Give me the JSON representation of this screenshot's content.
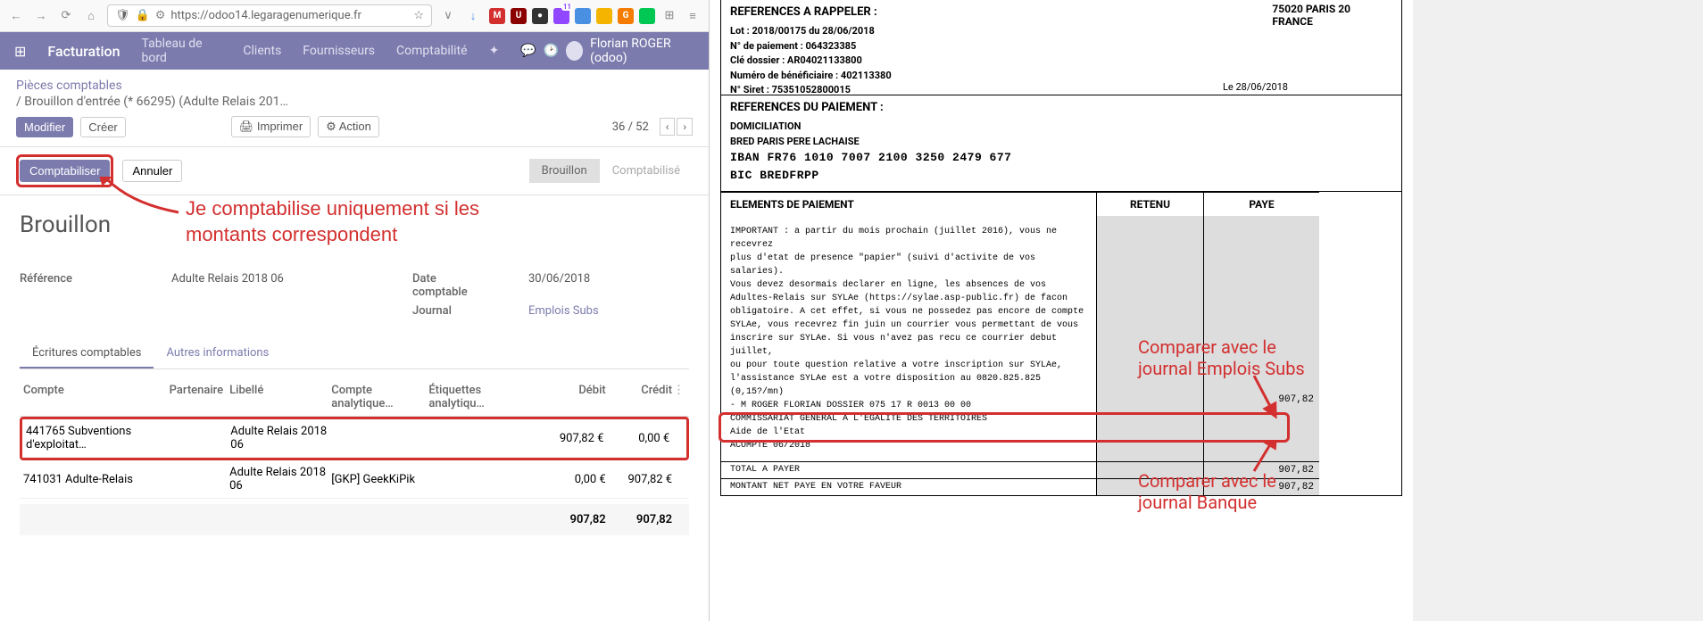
{
  "browser": {
    "url": "https://odoo14.legaragenumerique.fr",
    "badge": "11"
  },
  "odoo": {
    "app": "Facturation",
    "menu": [
      "Tableau de bord",
      "Clients",
      "Fournisseurs",
      "Comptabilité"
    ],
    "user": "Florian ROGER (odoo)",
    "breadcrumb1": "Pièces comptables",
    "breadcrumb2": "/ Brouillon d'entrée (* 66295) (Adulte Relais 201…",
    "btn_modifier": "Modifier",
    "btn_creer": "Créer",
    "btn_imprimer": "Imprimer",
    "btn_action": "Action",
    "pager": "36 / 52",
    "btn_comptabiliser": "Comptabiliser",
    "btn_annuler": "Annuler",
    "status_draft": "Brouillon",
    "status_posted": "Comptabilisé",
    "form_title": "Brouillon",
    "form": {
      "reference_label": "Référence",
      "reference_value": "Adulte Relais 2018 06",
      "date_label": "Date comptable",
      "date_value": "30/06/2018",
      "journal_label": "Journal",
      "journal_value": "Emplois Subs"
    },
    "tabs": {
      "t1": "Écritures comptables",
      "t2": "Autres informations"
    },
    "table": {
      "h_account": "Compte",
      "h_partner": "Partenaire",
      "h_label": "Libellé",
      "h_analytic": "Compte analytique…",
      "h_tags": "Étiquettes analytiqu…",
      "h_debit": "Débit",
      "h_credit": "Crédit",
      "rows": [
        {
          "account": "441765 Subventions d'exploitat…",
          "partner": "",
          "label": "Adulte Relais 2018 06",
          "analytic": "",
          "debit": "907,82 €",
          "credit": "0,00 €"
        },
        {
          "account": "741031 Adulte-Relais",
          "partner": "",
          "label": "Adulte Relais 2018 06",
          "analytic": "[GKP] GeekKiPik",
          "debit": "0,00 €",
          "credit": "907,82 €"
        }
      ],
      "total_debit": "907,82",
      "total_credit": "907,82"
    }
  },
  "annotations": {
    "a1_l1": "Je comptabilise uniquement si les",
    "a1_l2": "montants correspondent",
    "a2_l1": "Comparer avec le",
    "a2_l2": "journal Emplois Subs",
    "a3_l1": "Comparer avec le",
    "a3_l2": "journal Banque"
  },
  "pdf": {
    "addr1": "75020 PARIS 20",
    "addr2": "FRANCE",
    "date": "Le 28/06/2018",
    "sec1_title": "REFERENCES A RAPPELER :",
    "sec1_lines": [
      "Lot : 2018/00175 du 28/06/2018",
      "N° de paiement : 064323385",
      "Clé dossier : AR04021133800",
      "Numéro de bénéficiaire : 402113380",
      "N° Siret : 75351052800015"
    ],
    "sec2_title": "REFERENCES DU PAIEMENT :",
    "sec2_lines": [
      "DOMICILIATION",
      "BRED PARIS PERE LACHAISE"
    ],
    "sec2_iban": "IBAN  FR76 1010 7007 2100 3250 2479 677",
    "sec2_bic": "BIC   BREDFRPP",
    "elem_title": "ELEMENTS DE PAIEMENT",
    "col_retenu": "RETENU",
    "col_paye": "PAYE",
    "body_lines": [
      "IMPORTANT : a partir du mois prochain (juillet 2016), vous ne recevrez",
      "plus d'etat de presence \"papier\" (suivi d'activite de vos salaries).",
      "Vous devez desormais declarer en ligne, les absences de vos",
      "Adultes-Relais sur SYLAe (https://sylae.asp-public.fr) de facon",
      "obligatoire. A cet effet, si vous ne possedez pas encore de compte",
      "SYLAe, vous recevrez fin juin un courrier vous permettant de vous",
      "inscrire sur SYLAe. Si vous n'avez pas recu ce courrier debut juillet,",
      "ou pour toute question relative a votre inscription sur SYLAe,",
      "l'assistance SYLAe est a votre disposition au 0820.825.825 (0,15?/mn)",
      "",
      "- M ROGER FLORIAN                                    DOSSIER 075 17 R 0013 00 00",
      "  COMMISSARIAT GENERAL A L'EGALITE DES TERRITOIRES",
      "  Aide de l'Etat",
      "   ACOMPTE 06/2018"
    ],
    "paye_acompte": "907,82",
    "total_label": "TOTAL A PAYER",
    "total_val": "907,82",
    "net_label": "MONTANT NET PAYE EN VOTRE FAVEUR",
    "net_val": "907,82"
  }
}
